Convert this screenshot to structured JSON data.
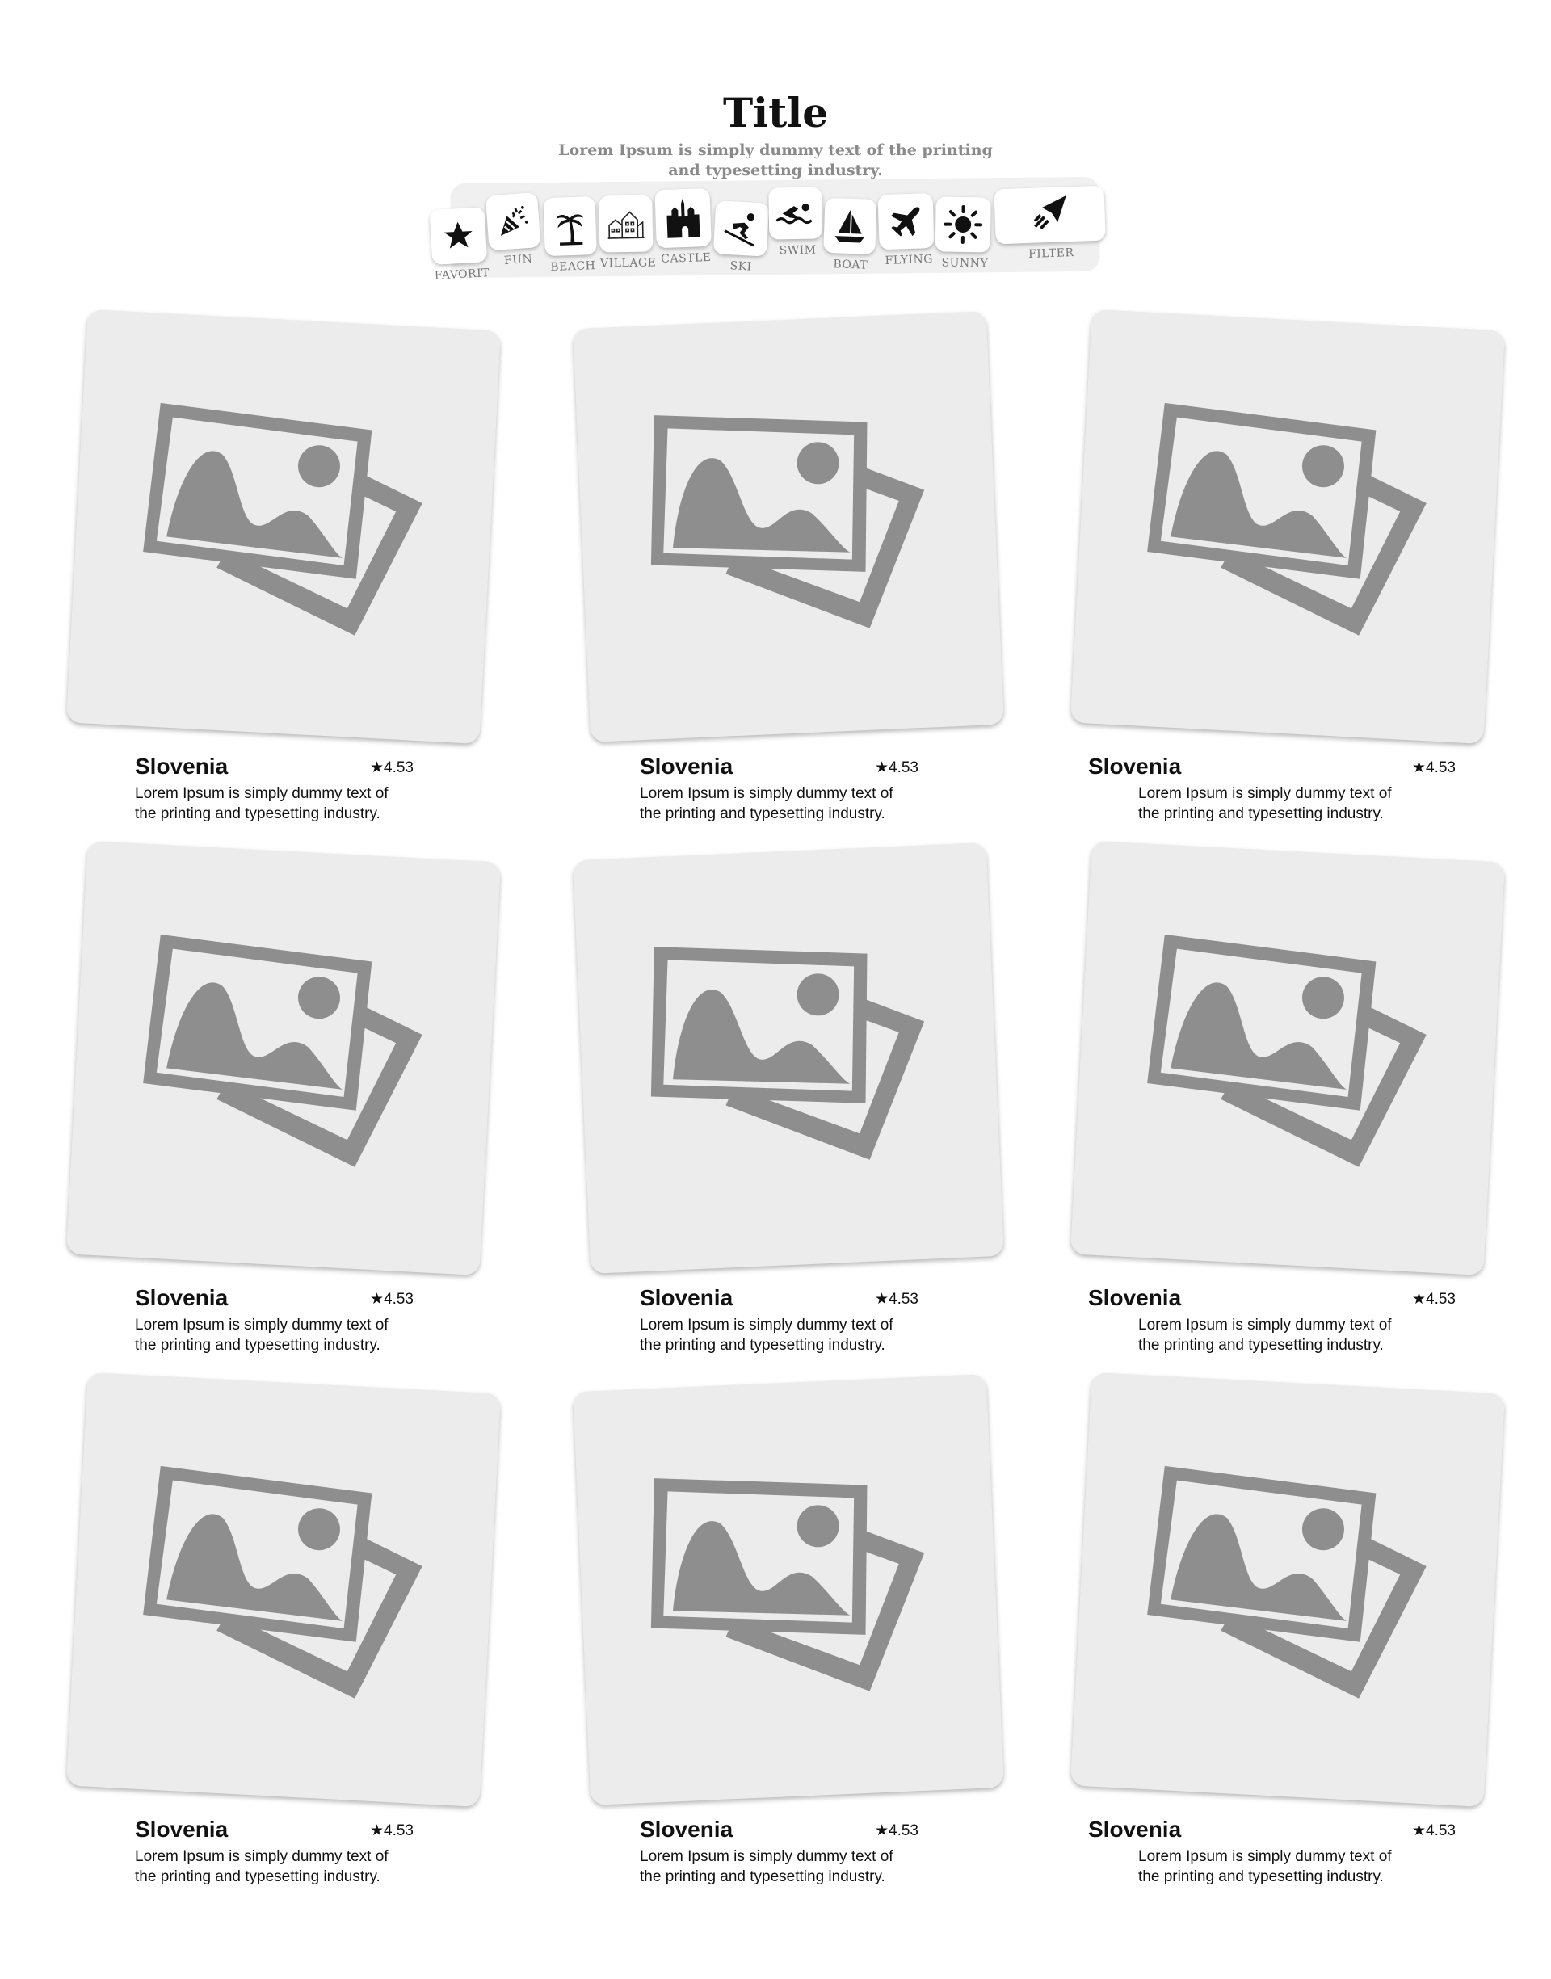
{
  "header": {
    "title": "Title",
    "subtitle": "Lorem Ipsum is simply dummy text of the printing and typesetting industry."
  },
  "categories": [
    {
      "label": "FAVORIT",
      "icon": "star-icon"
    },
    {
      "label": "FUN",
      "icon": "party-popper-icon"
    },
    {
      "label": "BEACH",
      "icon": "palm-tree-icon"
    },
    {
      "label": "VILLAGE",
      "icon": "village-icon"
    },
    {
      "label": "CASTLE",
      "icon": "castle-icon"
    },
    {
      "label": "SKI",
      "icon": "skier-icon"
    },
    {
      "label": "SWIM",
      "icon": "swimmer-icon"
    },
    {
      "label": "BOAT",
      "icon": "sailboat-icon"
    },
    {
      "label": "FLYING",
      "icon": "airplane-icon"
    },
    {
      "label": "SUNNY",
      "icon": "sun-icon"
    },
    {
      "label": "FILTER",
      "icon": "send-arrow-icon"
    }
  ],
  "cards": [
    {
      "name": "Slovenia",
      "rating": "4.53",
      "description": "Lorem Ipsum is simply dummy text of the printing and typesetting industry."
    },
    {
      "name": "Slovenia",
      "rating": "4.53",
      "description": "Lorem Ipsum is simply dummy text of the printing and typesetting industry."
    },
    {
      "name": "Slovenia",
      "rating": "4.53",
      "description": "Lorem Ipsum is simply dummy text of the printing and typesetting industry."
    },
    {
      "name": "Slovenia",
      "rating": "4.53",
      "description": "Lorem Ipsum is simply dummy text of the printing and typesetting industry."
    },
    {
      "name": "Slovenia",
      "rating": "4.53",
      "description": "Lorem Ipsum is simply dummy text of the printing and typesetting industry."
    },
    {
      "name": "Slovenia",
      "rating": "4.53",
      "description": "Lorem Ipsum is simply dummy text of the printing and typesetting industry."
    },
    {
      "name": "Slovenia",
      "rating": "4.53",
      "description": "Lorem Ipsum is simply dummy text of the printing and typesetting industry."
    },
    {
      "name": "Slovenia",
      "rating": "4.53",
      "description": "Lorem Ipsum is simply dummy text of the printing and typesetting industry."
    },
    {
      "name": "Slovenia",
      "rating": "4.53",
      "description": "Lorem Ipsum is simply dummy text of the printing and typesetting industry."
    }
  ],
  "colors": {
    "placeholder_bg": "#ececec",
    "placeholder_icon": "#8e8e8e",
    "category_bar": "#f0f0f0",
    "subtitle": "#8a8a8a"
  }
}
